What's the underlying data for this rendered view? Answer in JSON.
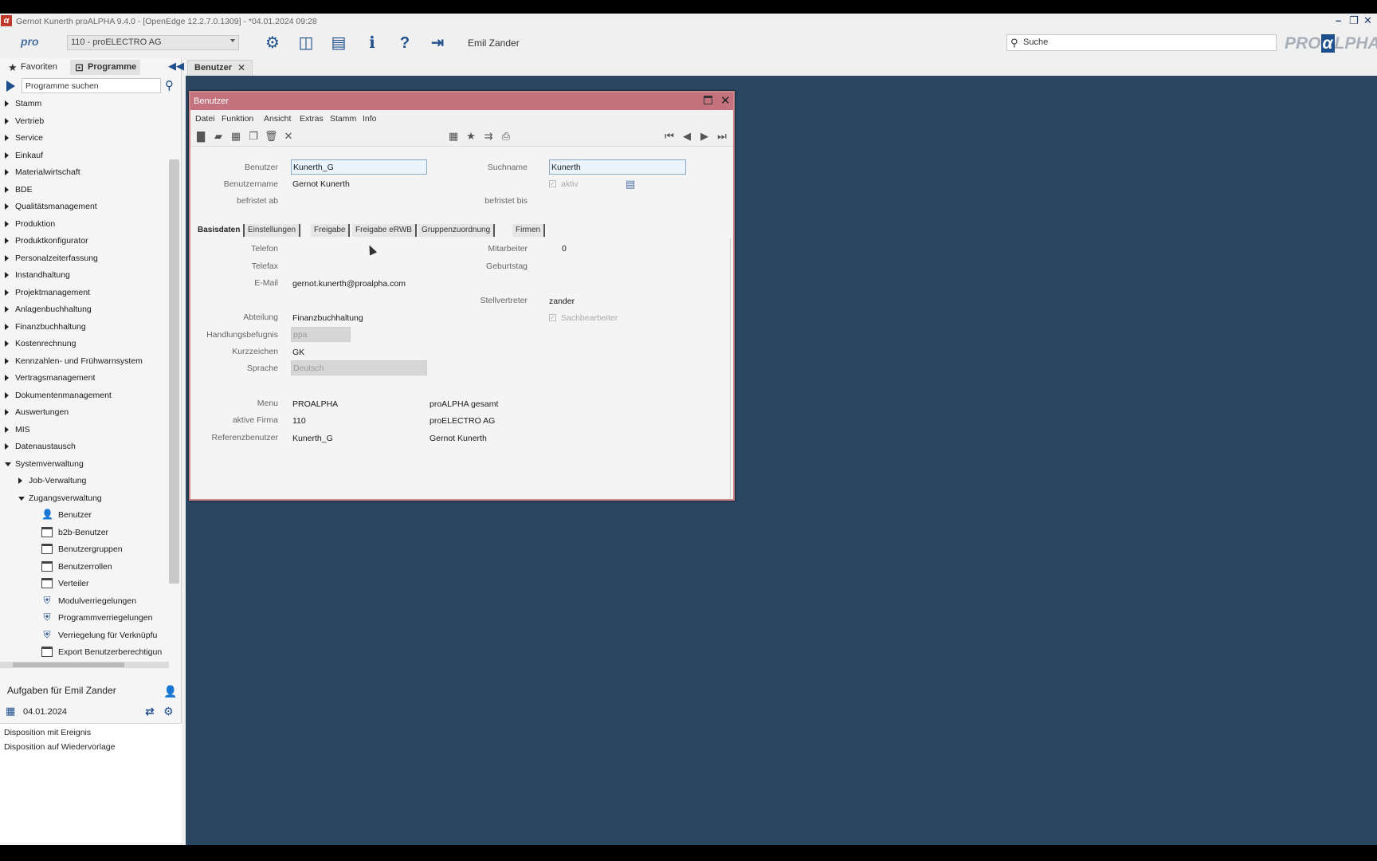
{
  "titlebar": {
    "title": "Gernot Kunerth proALPHA 9.4.0 - [OpenEdge 12.2.7.0.1309] - *04.01.2024 09:28",
    "logo": "α",
    "minimize_icon": "minimize-icon",
    "restore_icon": "restore-icon",
    "close_icon": "close-icon"
  },
  "toolbar": {
    "pro_logo": "pro",
    "company": "110 - proELECTRO AG",
    "user": "Emil Zander",
    "search_placeholder": "Suche",
    "brand_left": "PRO",
    "brand_mark": "α",
    "brand_right": "LPHA",
    "icons": [
      "gear-icon",
      "panel-icon",
      "window-icon",
      "info-icon",
      "help-icon",
      "exit-icon"
    ]
  },
  "sidebar": {
    "tabs": [
      {
        "label": "Favoriten",
        "icon": "star-icon"
      },
      {
        "label": "Programme",
        "icon": "programs-icon"
      }
    ],
    "search_placeholder": "Programme suchen",
    "tree": [
      {
        "label": "Stamm",
        "level": 0,
        "type": "folder"
      },
      {
        "label": "Vertrieb",
        "level": 0,
        "type": "folder"
      },
      {
        "label": "Service",
        "level": 0,
        "type": "folder"
      },
      {
        "label": "Einkauf",
        "level": 0,
        "type": "folder"
      },
      {
        "label": "Materialwirtschaft",
        "level": 0,
        "type": "folder"
      },
      {
        "label": "BDE",
        "level": 0,
        "type": "folder"
      },
      {
        "label": "Qualitätsmanagement",
        "level": 0,
        "type": "folder"
      },
      {
        "label": "Produktion",
        "level": 0,
        "type": "folder"
      },
      {
        "label": "Produktkonfigurator",
        "level": 0,
        "type": "folder"
      },
      {
        "label": "Personalzeiterfassung",
        "level": 0,
        "type": "folder"
      },
      {
        "label": "Instandhaltung",
        "level": 0,
        "type": "folder"
      },
      {
        "label": "Projektmanagement",
        "level": 0,
        "type": "folder"
      },
      {
        "label": "Anlagenbuchhaltung",
        "level": 0,
        "type": "folder"
      },
      {
        "label": "Finanzbuchhaltung",
        "level": 0,
        "type": "folder"
      },
      {
        "label": "Kostenrechnung",
        "level": 0,
        "type": "folder"
      },
      {
        "label": "Kennzahlen- und Frühwarnsystem",
        "level": 0,
        "type": "folder"
      },
      {
        "label": "Vertragsmanagement",
        "level": 0,
        "type": "folder"
      },
      {
        "label": "Dokumentenmanagement",
        "level": 0,
        "type": "folder"
      },
      {
        "label": "Auswertungen",
        "level": 0,
        "type": "folder"
      },
      {
        "label": "MIS",
        "level": 0,
        "type": "folder"
      },
      {
        "label": "Datenaustausch",
        "level": 0,
        "type": "folder"
      },
      {
        "label": "Systemverwaltung",
        "level": 0,
        "type": "open"
      },
      {
        "label": "Job-Verwaltung",
        "level": 1,
        "type": "folder"
      },
      {
        "label": "Zugangsverwaltung",
        "level": 1,
        "type": "open"
      },
      {
        "label": "Benutzer",
        "level": 2,
        "type": "user"
      },
      {
        "label": "b2b-Benutzer",
        "level": 2,
        "type": "window"
      },
      {
        "label": "Benutzergruppen",
        "level": 2,
        "type": "window"
      },
      {
        "label": "Benutzerrollen",
        "level": 2,
        "type": "window"
      },
      {
        "label": "Verteiler",
        "level": 2,
        "type": "window"
      },
      {
        "label": "Modulverriegelungen",
        "level": 2,
        "type": "shield"
      },
      {
        "label": "Programmverriegelungen",
        "level": 2,
        "type": "shield"
      },
      {
        "label": "Verriegelung für Verknüpfu",
        "level": 2,
        "type": "shield"
      },
      {
        "label": "Export Benutzerberechtigun",
        "level": 2,
        "type": "window"
      }
    ],
    "tasks_title": "Aufgaben für Emil Zander",
    "tasks_date": "04.01.2024",
    "tasks": [
      "Disposition mit Ereignis",
      "Disposition auf Wiedervorlage"
    ]
  },
  "doc_tab": {
    "label": "Benutzer"
  },
  "window": {
    "title": "Benutzer",
    "menu": [
      "Datei",
      "Funktion",
      "Ansicht",
      "Extras",
      "Stamm",
      "Info"
    ],
    "fields": {
      "benutzer_label": "Benutzer",
      "benutzer_value": "Kunerth_G",
      "suchname_label": "Suchname",
      "suchname_value": "Kunerth",
      "benutzername_label": "Benutzername",
      "benutzername_value": "Gernot Kunerth",
      "aktiv_label": "aktiv",
      "befristet_ab_label": "befristet ab",
      "befristet_bis_label": "befristet bis"
    },
    "tabs": [
      "Basisdaten",
      "Einstellungen",
      "Freigabe",
      "Freigabe eRWB",
      "Gruppenzuordnung",
      "Firmen"
    ],
    "basis": {
      "telefon_label": "Telefon",
      "telefax_label": "Telefax",
      "email_label": "E-Mail",
      "email_value": "gernot.kunerth@proalpha.com",
      "mitarbeiter_label": "Mitarbeiter",
      "mitarbeiter_value": "0",
      "geburtstag_label": "Geburtstag",
      "stellvertreter_label": "Stellvertreter",
      "stellvertreter_value": "zander",
      "abteilung_label": "Abteilung",
      "abteilung_value": "Finanzbuchhaltung",
      "sachbearbeiter_label": "Sachbearbeiter",
      "handlung_label": "Handlungsbefugnis",
      "handlung_value": "ppa",
      "kurzzeichen_label": "Kurzzeichen",
      "kurzzeichen_value": "GK",
      "sprache_label": "Sprache",
      "sprache_value": "Deutsch",
      "menu_label": "Menu",
      "menu_value": "PROALPHA",
      "menu_desc": "proALPHA gesamt",
      "firma_label": "aktive Firma",
      "firma_value": "110",
      "firma_desc": "proELECTRO AG",
      "ref_label": "Referenzbenutzer",
      "ref_value": "Kunerth_G",
      "ref_desc": "Gernot Kunerth"
    }
  }
}
